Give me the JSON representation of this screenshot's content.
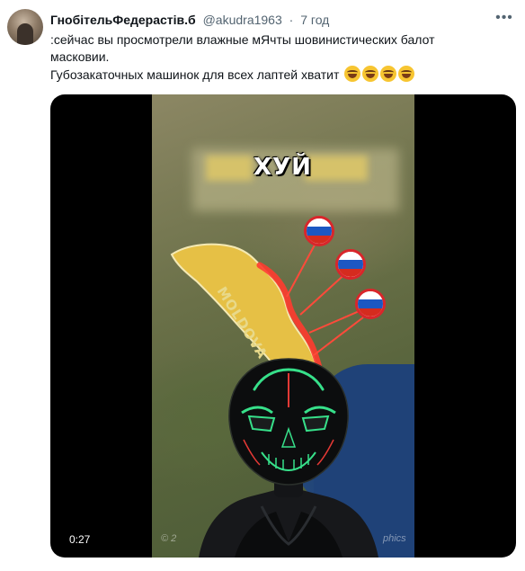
{
  "tweet": {
    "author_name": "ГнобітельФедерастів.б",
    "handle": "@akudra1963",
    "separator": "·",
    "time": "7 год",
    "line1": ":сейчас вы просмотрели влажные мЯчты шовинистических балот",
    "line2": "масковии.",
    "line3": "Губозакаточных машинок для всех лаптей хватит"
  },
  "emojis": [
    "joy-emoji",
    "joy-emoji",
    "joy-emoji",
    "joy-emoji"
  ],
  "video": {
    "overlay_word": "ХУЙ",
    "country_label": "MOLDOVA",
    "timestamp": "0:27",
    "credit_left": "© 2",
    "credit_right": "phics",
    "flags": [
      "russia-flag",
      "russia-flag",
      "russia-flag"
    ]
  },
  "colors": {
    "accent_text": "#536471",
    "country_fill": "#e6c045",
    "border_red": "#ff3b2f",
    "sea": "#1f4278"
  }
}
